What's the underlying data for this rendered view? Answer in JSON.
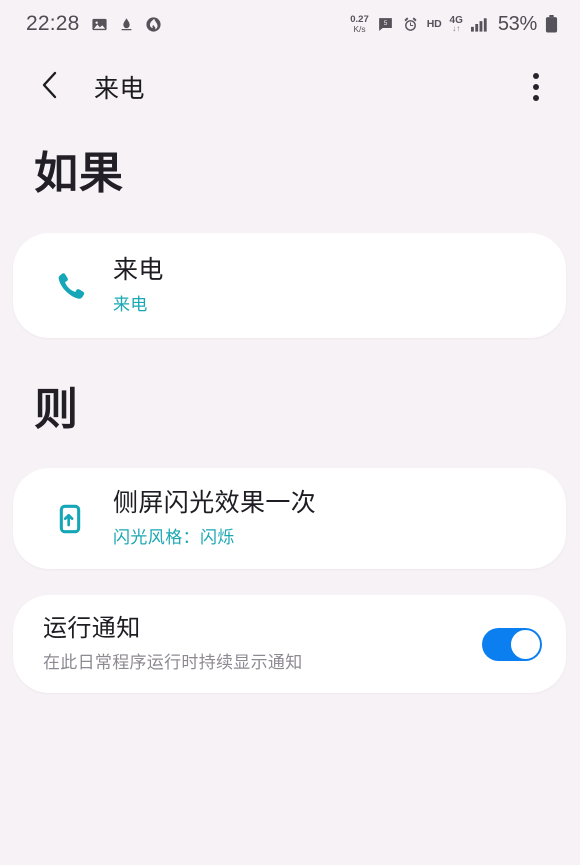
{
  "status_bar": {
    "time": "22:28",
    "left_icons": [
      "image-icon",
      "do-not-disturb-icon",
      "flame-icon"
    ],
    "net_speed_value": "0.27",
    "net_speed_unit": "K/s",
    "message_icon": "message-badge-icon",
    "alarm_icon": "alarm-icon",
    "hd_label": "HD",
    "network_gen": "4G",
    "network_arrows": "↓↑",
    "signal_icon": "signal-bars-icon",
    "battery_percent": "53%",
    "battery_icon": "battery-icon"
  },
  "app_bar": {
    "back_icon": "back-chevron-icon",
    "title": "来电",
    "overflow_icon": "more-vertical-icon"
  },
  "sections": {
    "if_heading": "如果",
    "then_heading": "则"
  },
  "trigger_card": {
    "icon": "phone-call-icon",
    "title": "来电",
    "subtitle": "来电"
  },
  "action_card": {
    "icon": "edge-lighting-icon",
    "title": "侧屏闪光效果一次",
    "subtitle": "闪光风格：闪烁"
  },
  "notification_row": {
    "title": "运行通知",
    "subtitle": "在此日常程序运行时持续显示通知",
    "toggle_state": "on",
    "toggle_name": "run-notification-toggle"
  },
  "colors": {
    "background": "#f7f2f6",
    "card": "#ffffff",
    "accent_teal": "#1aa8b4",
    "toggle_on": "#0b7ff0",
    "text_primary": "#1f1d23",
    "text_secondary": "#8d8a92"
  }
}
